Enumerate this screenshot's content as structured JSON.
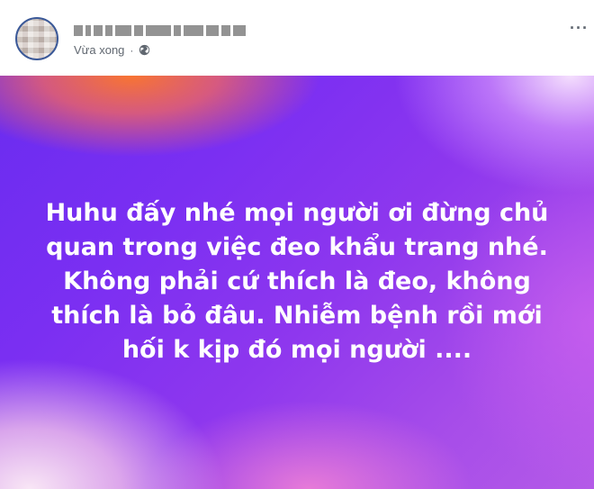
{
  "post": {
    "author_name": "",
    "timestamp": "Vừa xong",
    "separator": "·",
    "privacy_icon": "globe-icon",
    "more_icon": "more-options-icon",
    "more_label": "···",
    "text_lines": [
      "Huhu đấy nhé mọi người ơi đừng chủ",
      "quan trong việc đeo khẩu trang nhé.",
      "Không phải cứ thích là đeo, không",
      "thích là bỏ đâu. Nhiễm bệnh rồi mới",
      "hối k kịp đó mọi người ...."
    ],
    "background_colors": {
      "primary": "#7b2ff2",
      "accent_orange": "#ff7828",
      "accent_pink": "#ffd6ea"
    }
  }
}
